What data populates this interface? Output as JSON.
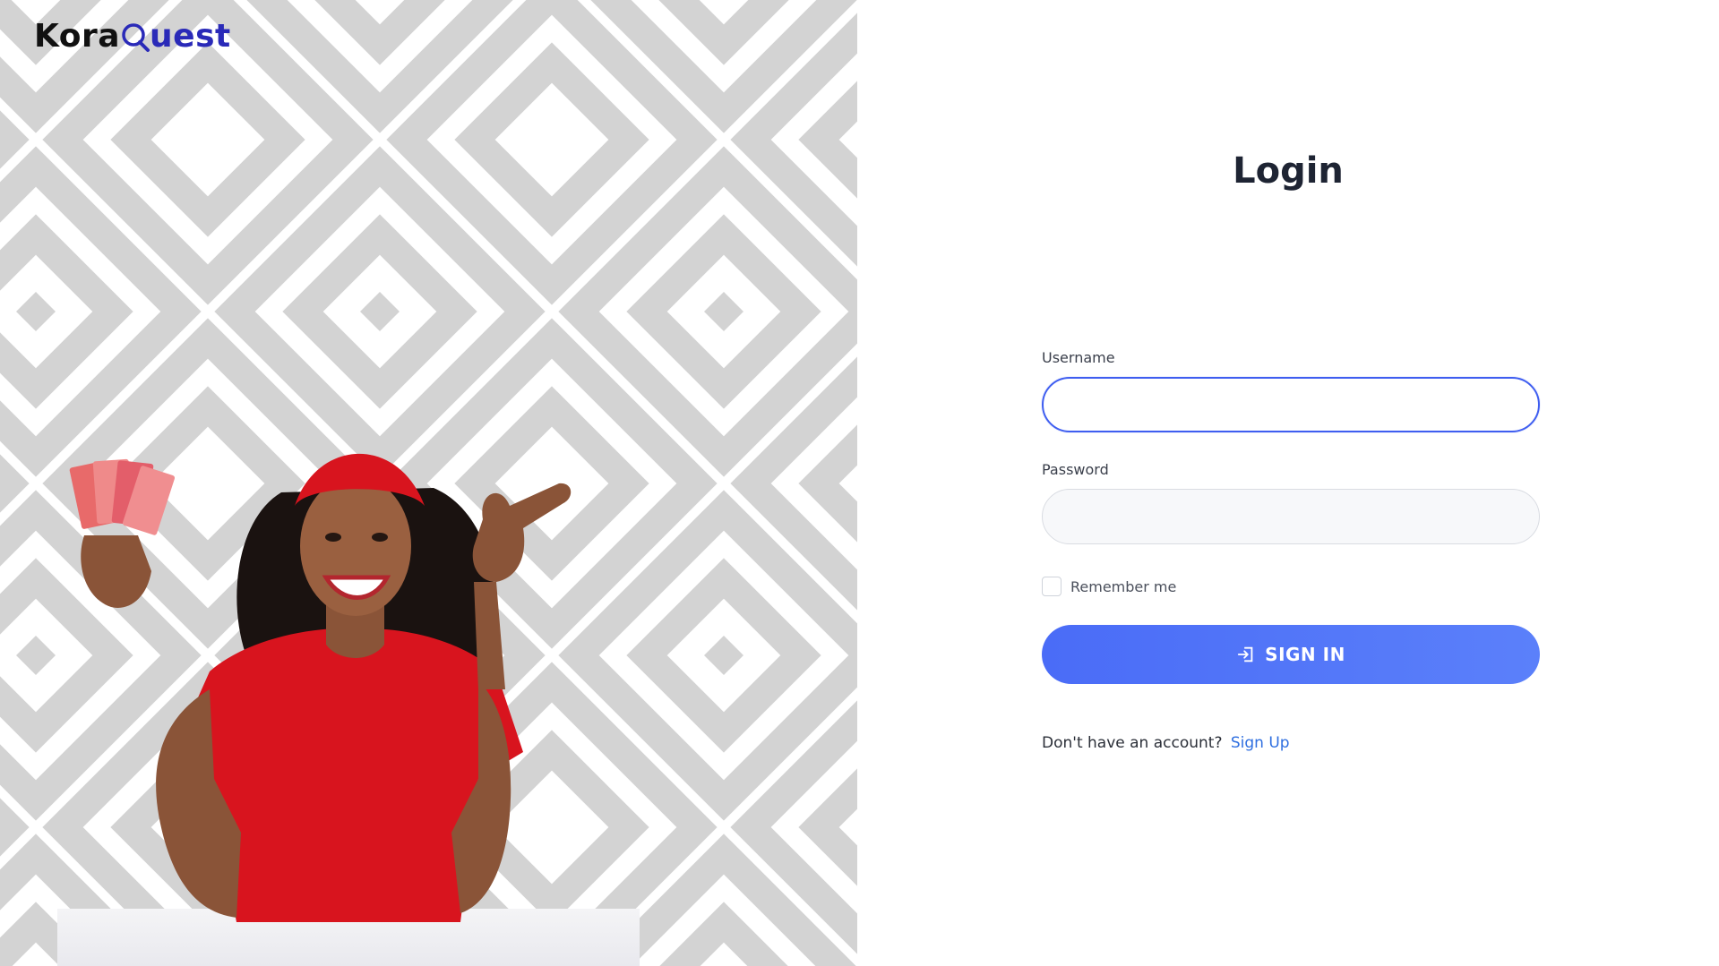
{
  "brand": {
    "part1": "Kora",
    "part2": "uest",
    "accent_color": "#2a2ab8",
    "dark_color": "#111111",
    "icon": "magnifier-q-icon"
  },
  "hero": {
    "pattern_color": "#d3d3d3",
    "image": "smiling-woman-holding-banknotes"
  },
  "login": {
    "title": "Login",
    "username_label": "Username",
    "username_value": "",
    "password_label": "Password",
    "password_value": "",
    "remember_label": "Remember me",
    "remember_checked": false,
    "signin_label": "SIGN IN",
    "signin_icon": "sign-in-icon",
    "signup_prompt": "Don't have an account?",
    "signup_link": "Sign Up",
    "button_color": "#4a6cf7",
    "link_color": "#2f6fe0"
  }
}
